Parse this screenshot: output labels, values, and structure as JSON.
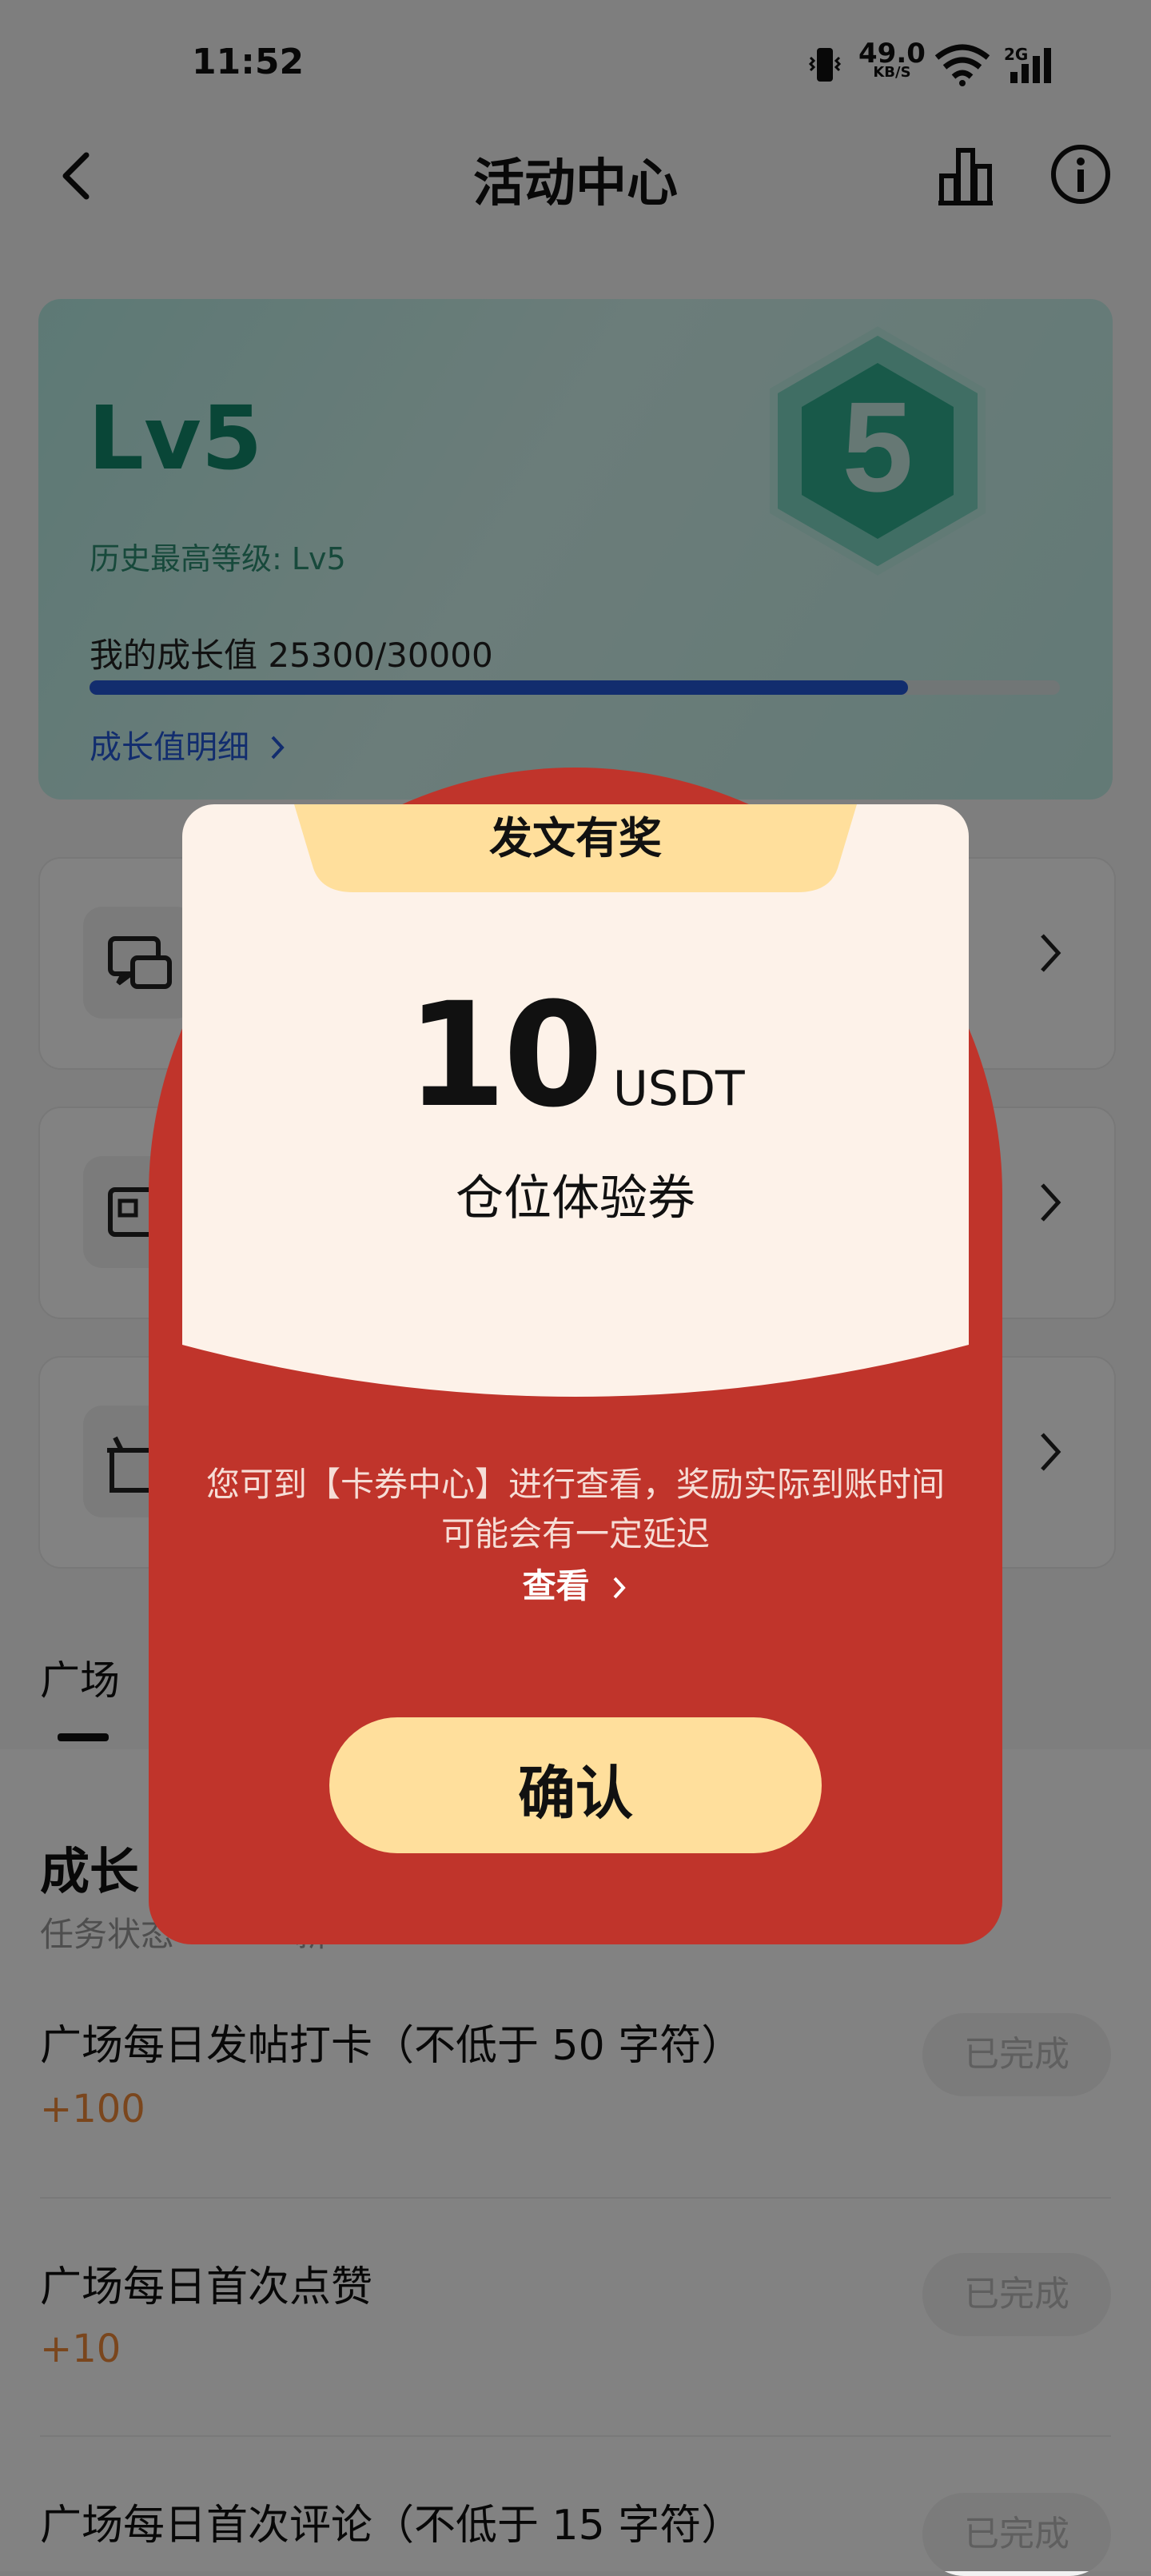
{
  "status_bar": {
    "time": "11:52",
    "speed_value": "49.0",
    "speed_unit": "KB/S",
    "network": "2G"
  },
  "header": {
    "title": "活动中心",
    "back_icon": "chevron-left-icon",
    "chart_icon": "bar-chart-icon",
    "info_icon": "info-icon"
  },
  "level_card": {
    "level": "Lv5",
    "history": "历史最高等级: Lv5",
    "growth_text": "我的成长值 25300/30000",
    "progress_fraction": 0.8433,
    "detail_link": "成长值明细",
    "badge_number": "5"
  },
  "tabs": {
    "plaza": "广场"
  },
  "growth_section": {
    "title": "成长",
    "subtitle_left": "任务状态",
    "subtitle_right": "新"
  },
  "tasks": [
    {
      "name": "广场每日发帖打卡（不低于 50 字符）",
      "points": "+100",
      "status": "已完成"
    },
    {
      "name": "广场每日首次点赞",
      "points": "+10",
      "status": "已完成"
    },
    {
      "name": "广场每日首次评论（不低于 15 字符）",
      "points": "",
      "status": "已完成"
    }
  ],
  "modal": {
    "tab_title": "发文有奖",
    "amount": "10",
    "unit": "USDT",
    "coupon": "仓位体验券",
    "info": "您可到【卡券中心】进行查看，奖励实际到账时间可能会有一定延迟",
    "view": "查看",
    "confirm": "确认"
  },
  "colors": {
    "brand_green": "#128a6d",
    "progress_blue": "#2459d8",
    "envelope_red": "#c0342b",
    "button_gold": "#ffdf9c",
    "points_orange": "#f08a3a"
  }
}
